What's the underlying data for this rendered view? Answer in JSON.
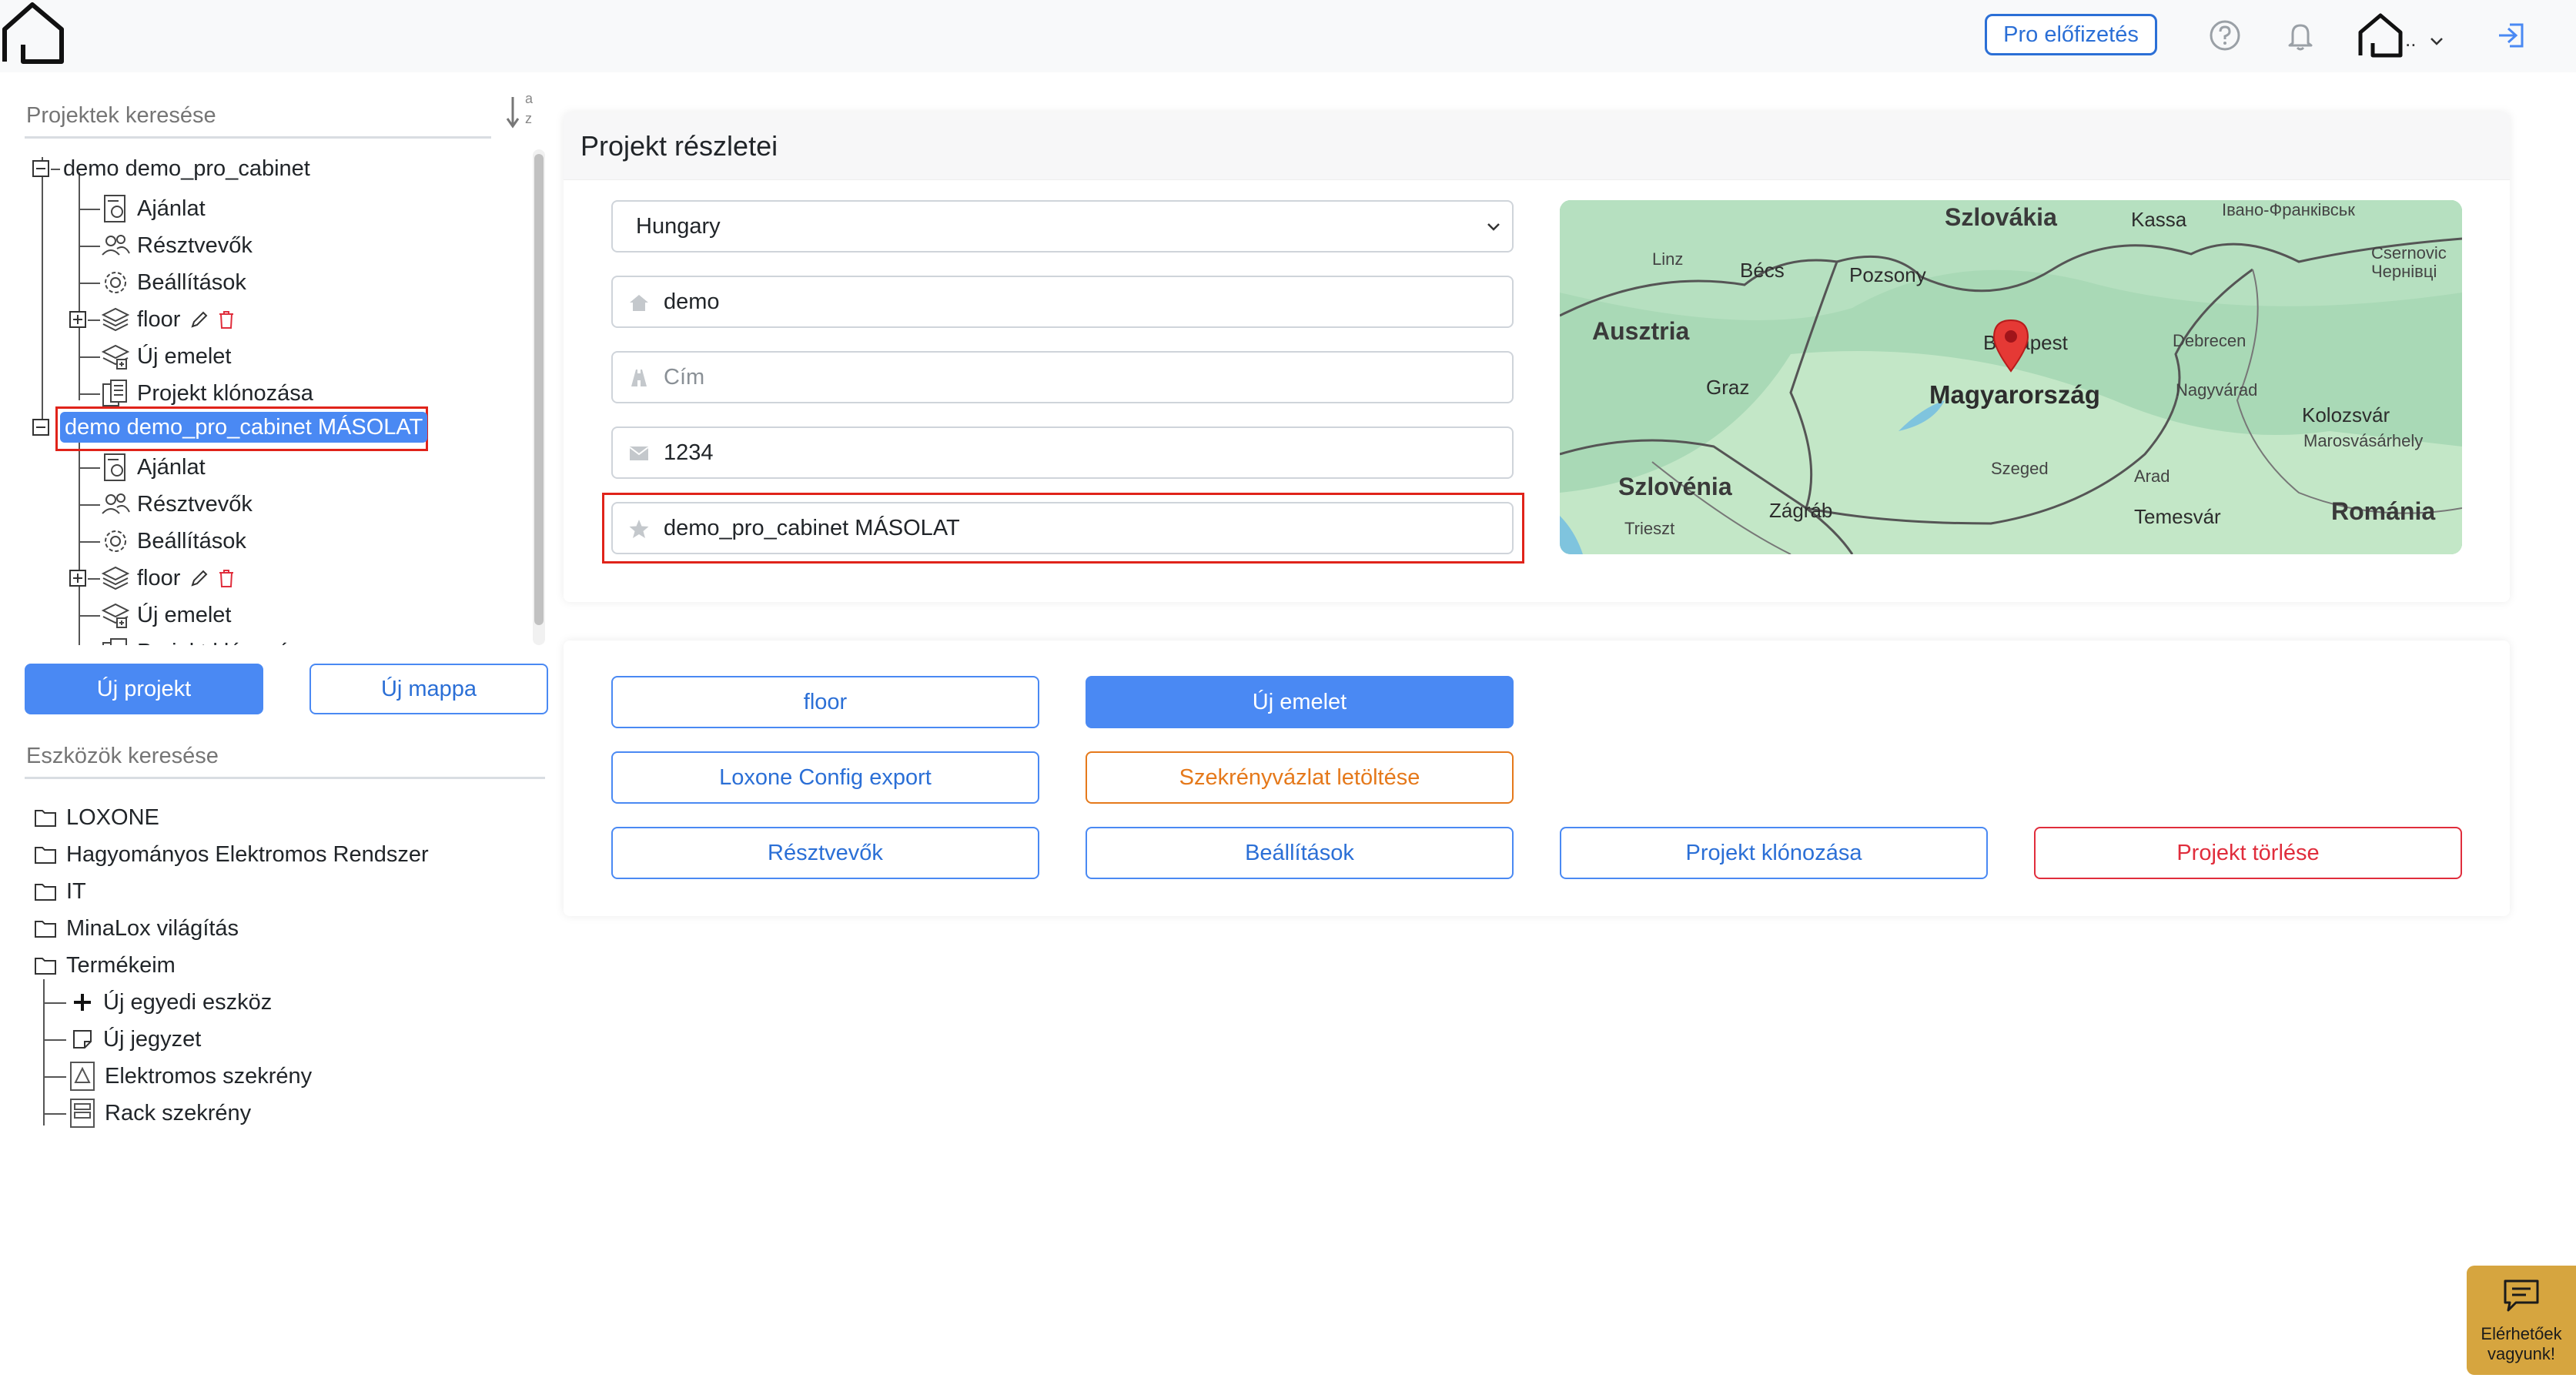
{
  "header": {
    "pro_label": "Pro előfizetés",
    "avatar_text": ".."
  },
  "sidebar": {
    "project_search_placeholder": "Projektek keresése",
    "tools_search_placeholder": "Eszközök keresése",
    "sort_letters": {
      "top": "a",
      "bottom": "z"
    },
    "projects": [
      {
        "label": "demo demo_pro_cabinet",
        "children": {
          "offer": "Ajánlat",
          "participants": "Résztvevők",
          "settings": "Beállítások",
          "floor": "floor",
          "new_floor": "Új emelet",
          "clone": "Projekt klónozása"
        }
      },
      {
        "label": "demo demo_pro_cabinet MÁSOLAT",
        "children": {
          "offer": "Ajánlat",
          "participants": "Résztvevők",
          "settings": "Beállítások",
          "floor": "floor",
          "new_floor": "Új emelet",
          "clone": "Projekt klónozása"
        }
      }
    ],
    "new_project_label": "Új projekt",
    "new_folder_label": "Új mappa",
    "tool_folders": [
      "LOXONE",
      "Hagyományos Elektromos Rendszer",
      "IT",
      "MinaLox világítás",
      "Termékeim"
    ],
    "my_products": {
      "new_device": "Új egyedi eszköz",
      "new_note": "Új jegyzet",
      "electric_cabinet": "Elektromos szekrény",
      "rack_cabinet": "Rack szekrény"
    }
  },
  "details": {
    "title": "Projekt részletei",
    "country": "Hungary",
    "city": "demo",
    "address_placeholder": "Cím",
    "zip": "1234",
    "name": "demo_pro_cabinet MÁSOLAT"
  },
  "map": {
    "labels": {
      "slovakia": "Szlovákia",
      "kassa": "Kassa",
      "ivano": "Івано-Франківськ",
      "linz": "Linz",
      "becs": "Bécs",
      "pozsony": "Pozsony",
      "csernovic": "Csernovic",
      "chernivtsi": "Чернівці",
      "austria": "Ausztria",
      "budapest": "Budapest",
      "debrecen": "Debrecen",
      "graz": "Graz",
      "hungary": "Magyarország",
      "nagyvarad": "Nagyvárad",
      "kolozsvar": "Kolozsvár",
      "marosvasarhely": "Marosvásárhely",
      "szeged": "Szeged",
      "arad": "Arad",
      "slovenia": "Szlovénia",
      "trieszt": "Trieszt",
      "zagrab": "Zágráb",
      "temesvar": "Temesvár",
      "romania": "Románia"
    }
  },
  "actions": {
    "floor": "floor",
    "new_floor": "Új emelet",
    "loxone_export": "Loxone Config export",
    "cabinet_download": "Szekrényvázlat letöltése",
    "participants": "Résztvevők",
    "settings": "Beállítások",
    "clone": "Projekt klónozása",
    "delete": "Projekt törlése"
  },
  "chat": {
    "line1": "Elérhetőek",
    "line2": "vagyunk!"
  },
  "colors": {
    "primary": "#4a89f3",
    "outline_blue": "#2b6fd6",
    "orange": "#e5791b",
    "danger": "#e02d3c",
    "highlight": "#e0231a",
    "chat": "#d6a53f"
  }
}
